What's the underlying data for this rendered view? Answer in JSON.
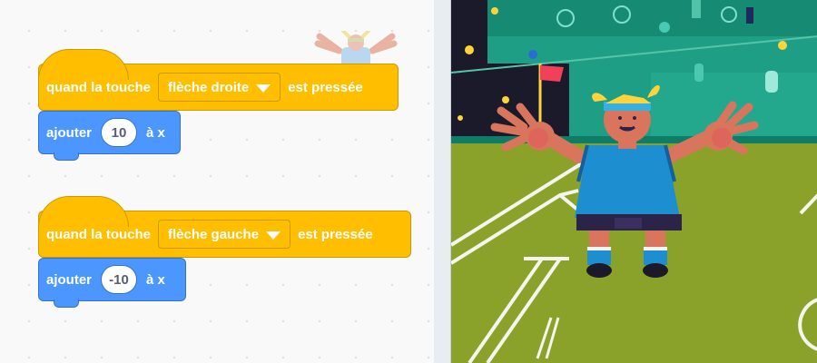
{
  "scripts": [
    {
      "hat": {
        "prefix": "quand la touche",
        "key": "flèche droite",
        "suffix": "est pressée"
      },
      "action": {
        "label": "ajouter",
        "value": "10",
        "suffix": "à x"
      }
    },
    {
      "hat": {
        "prefix": "quand la touche",
        "key": "flèche gauche",
        "suffix": "est pressée"
      },
      "action": {
        "label": "ajouter",
        "value": "-10",
        "suffix": "à x"
      }
    }
  ],
  "icons": {
    "sprite_thumbnail": "player-sprite-icon",
    "dropdown_arrow": "chevron-down-icon"
  },
  "colors": {
    "events_block": "#ffbf00",
    "motion_block": "#4c97ff",
    "stage_grass": "#8aa12a",
    "stage_stands": "#1fa08a",
    "player_shirt": "#1d8fd1"
  }
}
